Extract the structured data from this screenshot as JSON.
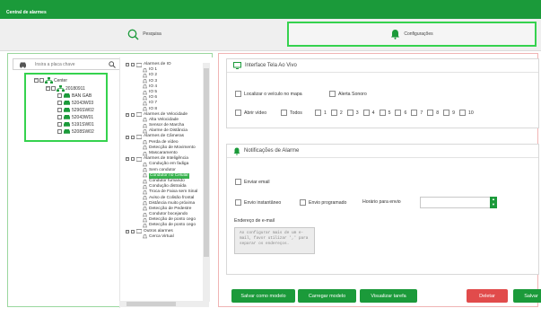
{
  "app": {
    "title": "Central de alarmes"
  },
  "toolbar": {
    "search_label": "Pesquisa",
    "config_label": "Configurações"
  },
  "search": {
    "placeholder": "Insira a placa chave"
  },
  "vehicles": {
    "root": "Center",
    "group": "20180911",
    "items": [
      "BAN GAB",
      "52043W03",
      "5296SW02",
      "52043W01",
      "5191SW01",
      "5208SW02"
    ]
  },
  "alarm_tree": [
    {
      "label": "Alarmes de IO",
      "children": [
        "IO 1",
        "IO 2",
        "IO 3",
        "IO 4",
        "IO 5",
        "IO 6",
        "IO 7",
        "IO 8"
      ]
    },
    {
      "label": "Alarmes de Velocidade",
      "children": [
        "Alta Velocidade",
        "Sensor de Marcha",
        "Alarme de Distância"
      ]
    },
    {
      "label": "Alarmes de Câmeras",
      "children": [
        "Perda de vídeo",
        "Detecção de Movimento",
        "Mascaramento"
      ]
    },
    {
      "label": "Alarmes de Inteligência",
      "children": [
        "Condução em fadiga",
        "Sem condutor",
        "Condutor no Celular",
        "Condutor fumando",
        "Condução distraída",
        "Troca de Faixa sem Sinal",
        "Aviso de Colisão frontal",
        "Distância muito próxima",
        "Detecção de Pedestre",
        "Condutor bocejando",
        "Detecção de ponto cego",
        "Detecção de ponto cego"
      ]
    },
    {
      "label": "Outros alarmes",
      "children": [
        "Cerca Virtual"
      ]
    }
  ],
  "interface_section": {
    "title": "Interface Tela Ao Vivo",
    "locate_vehicle_label": "Localizar o veículo no mapa",
    "sound_alert_label": "Alerta Sonoro",
    "open_video_label": "Abrir vídeo",
    "all_label": "Todos",
    "channels": [
      "1",
      "2",
      "3",
      "4",
      "5",
      "6",
      "7",
      "8",
      "9",
      "10"
    ]
  },
  "notifications_section": {
    "title": "Notificações de Alarme",
    "send_email_label": "Enviar email",
    "instant_label": "Envio instantâneo",
    "scheduled_label": "Envio programado",
    "schedule_time_label": "Horário para envio",
    "email_address_label": "Endereço de e-mail",
    "email_placeholder": "Ao configurar mais de um e-mail, favor utilizar ',' para separar os endereços."
  },
  "actions": {
    "save_model_label": "Salvar como modelo",
    "load_model_label": "Carregar modelo",
    "view_task_label": "Visualizar tarefa",
    "delete_label": "Deletar",
    "save_label": "Salvar"
  },
  "colors": {
    "brand_green": "#1b9a3a",
    "highlight_green": "#35d24e",
    "delete_red": "#e14b4b"
  }
}
